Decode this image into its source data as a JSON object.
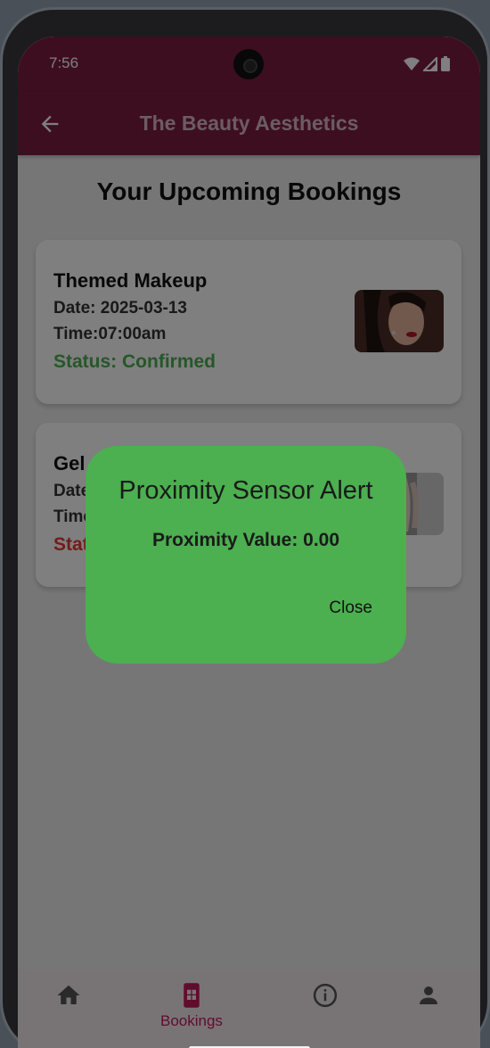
{
  "status_bar": {
    "time": "7:56"
  },
  "app_bar": {
    "title": "The Beauty Aesthetics"
  },
  "page": {
    "title": "Your Upcoming Bookings"
  },
  "bookings": [
    {
      "service": "Themed Makeup",
      "date": "Date: 2025-03-13",
      "time": "Time:07:00am",
      "status": "Status: Confirmed",
      "status_color": "#4caf50"
    },
    {
      "service": "Gel C",
      "date": "Date",
      "time": "Time",
      "status": "Stat",
      "status_color": "#e53935"
    }
  ],
  "dialog": {
    "title": "Proximity Sensor Alert",
    "body": "Proximity Value: 0.00",
    "close_label": "Close",
    "background": "#4caf50"
  },
  "bottom_nav": {
    "items": [
      {
        "icon": "home-icon",
        "label": ""
      },
      {
        "icon": "bookings-icon",
        "label": "Bookings"
      },
      {
        "icon": "info-icon",
        "label": ""
      },
      {
        "icon": "person-icon",
        "label": ""
      }
    ],
    "active_color": "#c2185b"
  },
  "colors": {
    "primary": "#7b1c41",
    "accent": "#c2185b"
  }
}
